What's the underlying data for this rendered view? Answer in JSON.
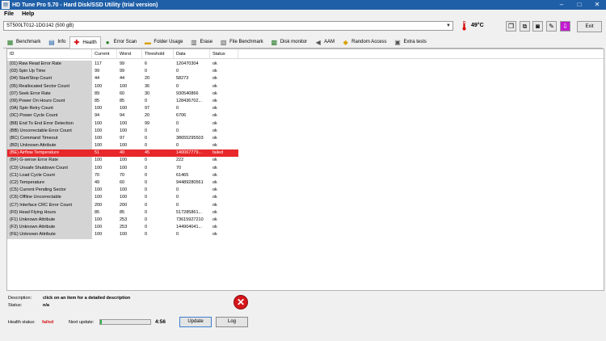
{
  "window": {
    "title": "HD Tune Pro 5.70 - Hard Disk/SSD Utility (trial version)"
  },
  "menu": [
    "File",
    "Help"
  ],
  "drive": {
    "selected": "ST500LT012-1DG142 (500 gB)",
    "temperature": "49°C"
  },
  "toolbar": {
    "exit_label": "Exit"
  },
  "tabs": [
    {
      "label": "Benchmark",
      "icon": "benchmark-icon"
    },
    {
      "label": "Info",
      "icon": "info-icon"
    },
    {
      "label": "Health",
      "icon": "health-cross-icon"
    },
    {
      "label": "Error Scan",
      "icon": "magnifier-icon"
    },
    {
      "label": "Folder Usage",
      "icon": "folder-icon"
    },
    {
      "label": "Erase",
      "icon": "erase-icon"
    },
    {
      "label": "File Benchmark",
      "icon": "file-icon"
    },
    {
      "label": "Disk monitor",
      "icon": "disk-monitor-icon"
    },
    {
      "label": "AAM",
      "icon": "speaker-icon"
    },
    {
      "label": "Random Access",
      "icon": "random-access-icon"
    },
    {
      "label": "Extra tests",
      "icon": "extra-tests-icon"
    }
  ],
  "active_tab": "Health",
  "table": {
    "headers": [
      "ID",
      "Current",
      "Worst",
      "Threshold",
      "Data",
      "Status"
    ],
    "rows": [
      [
        "(01) Raw Read Error Rate",
        "117",
        "99",
        "6",
        "120470304",
        "ok"
      ],
      [
        "(03) Spin Up Time",
        "99",
        "99",
        "0",
        "0",
        "ok"
      ],
      [
        "(04) Start/Stop Count",
        "44",
        "44",
        "20",
        "58273",
        "ok"
      ],
      [
        "(05) Reallocated Sector Count",
        "100",
        "100",
        "36",
        "0",
        "ok"
      ],
      [
        "(07) Seek Error Rate",
        "89",
        "60",
        "30",
        "930540866",
        "ok"
      ],
      [
        "(09) Power On Hours Count",
        "85",
        "85",
        "0",
        "128436702...",
        "ok"
      ],
      [
        "(0A) Spin Retry Count",
        "100",
        "100",
        "97",
        "0",
        "ok"
      ],
      [
        "(0C) Power Cycle Count",
        "94",
        "94",
        "20",
        "6706",
        "ok"
      ],
      [
        "(B8) End To End Error Detection",
        "100",
        "100",
        "99",
        "0",
        "ok"
      ],
      [
        "(BB) Uncorrectable Error Count",
        "100",
        "100",
        "0",
        "0",
        "ok"
      ],
      [
        "(BC) Command Timeout",
        "100",
        "97",
        "0",
        "38655295503",
        "ok"
      ],
      [
        "(BD) Unknown Attribute",
        "100",
        "100",
        "0",
        "0",
        "ok"
      ],
      [
        "(BE) Airflow Temperature",
        "51",
        "40",
        "45",
        "140067779...",
        "failed"
      ],
      [
        "(BF) G-sense Error Rate",
        "100",
        "100",
        "0",
        "222",
        "ok"
      ],
      [
        "(C0) Unsafe Shutdown Count",
        "100",
        "100",
        "0",
        "70",
        "ok"
      ],
      [
        "(C1) Load Cycle Count",
        "70",
        "70",
        "0",
        "61465",
        "ok"
      ],
      [
        "(C2) Temperature",
        "49",
        "60",
        "0",
        "94489280561",
        "ok"
      ],
      [
        "(C5) Current Pending Sector",
        "100",
        "100",
        "0",
        "0",
        "ok"
      ],
      [
        "(C6) Offline Uncorrectable",
        "100",
        "100",
        "0",
        "0",
        "ok"
      ],
      [
        "(C7) Interface CRC Error Count",
        "200",
        "200",
        "0",
        "0",
        "ok"
      ],
      [
        "(F0) Head Flying Hours",
        "85",
        "85",
        "0",
        "517285861...",
        "ok"
      ],
      [
        "(F1) Unknown Attribute",
        "100",
        "253",
        "0",
        "73615927210",
        "ok"
      ],
      [
        "(F2) Unknown Attribute",
        "100",
        "253",
        "0",
        "144904041...",
        "ok"
      ],
      [
        "(FE) Unknown Attribute",
        "100",
        "100",
        "0",
        "0",
        "ok"
      ]
    ],
    "failed_row_color": "#e8272a"
  },
  "description": {
    "label": "Description:",
    "value": "click on an item for a detailed description",
    "status_label": "Status:",
    "status_value": "n/a"
  },
  "footer": {
    "health_label": "Health status:",
    "health_value": "failed",
    "next_label": "Next update:",
    "next_progress": 0.03,
    "time": "4:56",
    "update_label": "Update",
    "log_label": "Log"
  }
}
